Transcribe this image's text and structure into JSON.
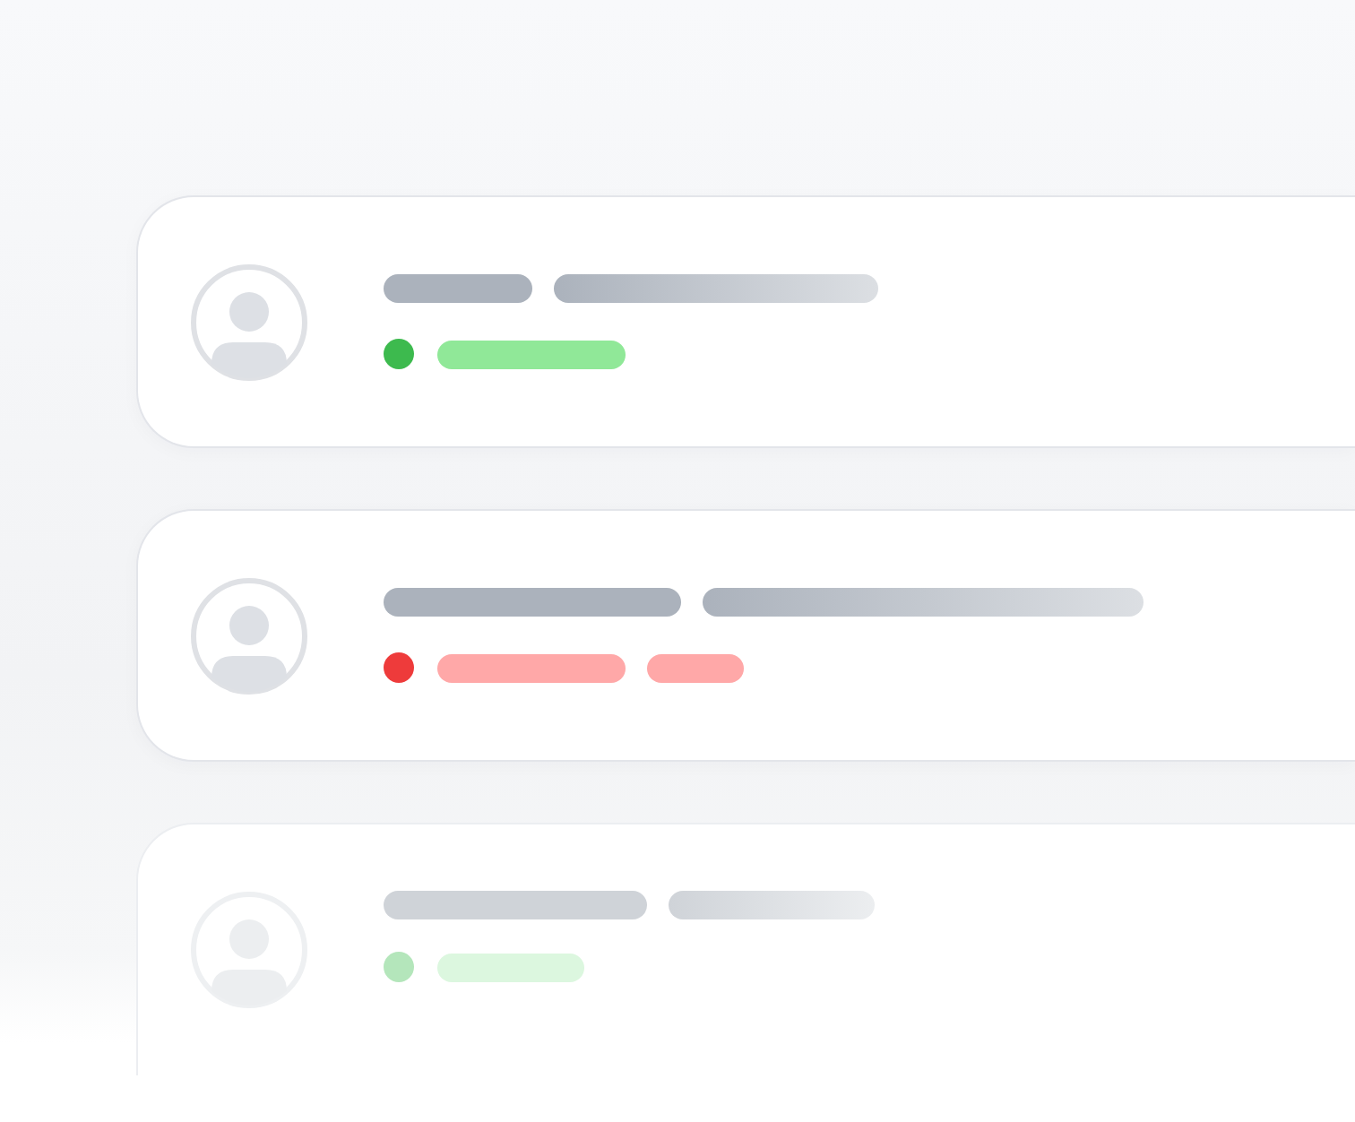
{
  "cards": [
    {
      "faded": false,
      "color": "#3dba4e",
      "tags": [
        {
          "color": "#90e898"
        }
      ]
    },
    {
      "faded": false,
      "color": "#ee3b3b",
      "tags": [
        {
          "color": "#ffa8a8"
        },
        {
          "color": "#ffa8a8"
        }
      ]
    },
    {
      "faded": true,
      "color": "#b4e6bb",
      "tags": [
        {
          "color": "#dcf7df"
        }
      ]
    }
  ]
}
